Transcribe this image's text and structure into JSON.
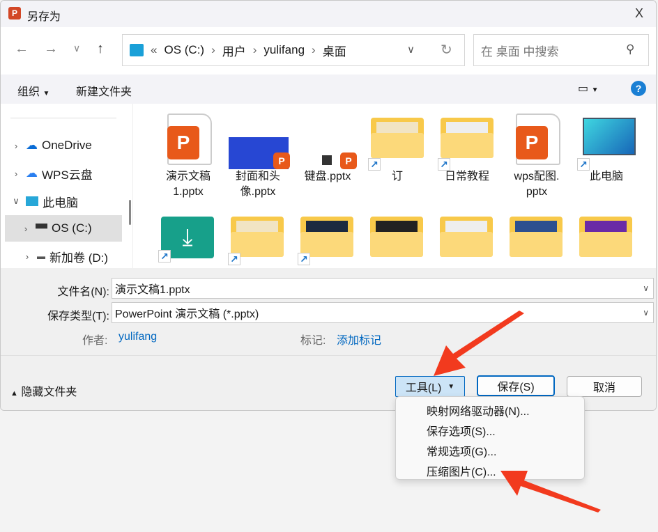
{
  "window": {
    "title": "另存为",
    "close": "X"
  },
  "nav": {
    "breadcrumb": [
      "«",
      "OS (C:)",
      "用户",
      "yulifang",
      "桌面"
    ],
    "search_placeholder": "在 桌面 中搜索"
  },
  "toolbar": {
    "organize": "组织",
    "new_folder": "新建文件夹",
    "help": "?"
  },
  "tree": [
    {
      "label": "OneDrive"
    },
    {
      "label": "WPS云盘"
    },
    {
      "label": "此电脑"
    },
    {
      "label": "OS (C:)",
      "selected": true
    },
    {
      "label": "新加卷 (D:)"
    }
  ],
  "files": [
    {
      "name": "演示文稿\n1.pptx",
      "type": "pptx"
    },
    {
      "name": "封面和头\n像.pptx",
      "type": "pptx-thumb"
    },
    {
      "name": "键盘.pptx",
      "type": "pptx-thumb"
    },
    {
      "name": "订",
      "type": "folder-shortcut"
    },
    {
      "name": "日常教程",
      "type": "folder-shortcut"
    },
    {
      "name": "wps配图.\npptx",
      "type": "pptx"
    },
    {
      "name": "此电脑",
      "type": "pc-shortcut"
    }
  ],
  "form": {
    "filename_label": "文件名(N):",
    "filename": "演示文稿1.pptx",
    "type_label": "保存类型(T):",
    "type": "PowerPoint 演示文稿 (*.pptx)",
    "author_label": "作者:",
    "author": "yulifang",
    "tags_label": "标记:",
    "tags": "添加标记"
  },
  "footer": {
    "hide_folders": "隐藏文件夹",
    "tools": "工具(L)",
    "save": "保存(S)",
    "cancel": "取消"
  },
  "menu": [
    "映射网络驱动器(N)...",
    "保存选项(S)...",
    "常规选项(G)...",
    "压缩图片(C)..."
  ],
  "colors": {
    "accent": "#0067c0",
    "arrow": "#f23a1e",
    "ppt": "#e8591a"
  }
}
